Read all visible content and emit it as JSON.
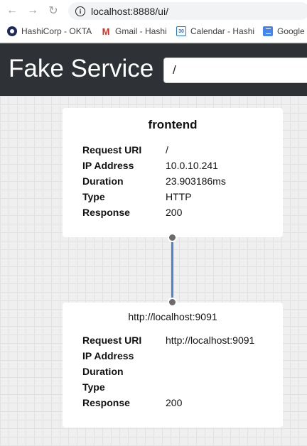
{
  "browser": {
    "url": "localhost:8888/ui/",
    "bookmarks": [
      {
        "label": "HashiCorp - OKTA",
        "icon": "okta-icon"
      },
      {
        "label": "Gmail - Hashi",
        "icon": "gmail-icon"
      },
      {
        "label": "Calendar - Hashi",
        "icon": "calendar-icon"
      },
      {
        "label": "Google",
        "icon": "docs-icon"
      }
    ],
    "gmail_glyph": "M",
    "calendar_glyph": "30"
  },
  "app": {
    "title": "Fake Service",
    "path_value": "/"
  },
  "nodes": [
    {
      "name": "frontend",
      "fields": [
        {
          "key": "Request URI",
          "value": "/"
        },
        {
          "key": "IP Address",
          "value": "10.0.10.241"
        },
        {
          "key": "Duration",
          "value": "23.903186ms"
        },
        {
          "key": "Type",
          "value": "HTTP"
        },
        {
          "key": "Response",
          "value": "200"
        }
      ]
    },
    {
      "name": "http://localhost:9091",
      "fields": [
        {
          "key": "Request URI",
          "value": "http://localhost:9091"
        },
        {
          "key": "IP Address",
          "value": ""
        },
        {
          "key": "Duration",
          "value": ""
        },
        {
          "key": "Type",
          "value": ""
        },
        {
          "key": "Response",
          "value": "200"
        }
      ]
    }
  ],
  "colors": {
    "header_bg": "#2e3136",
    "connector": "#4a82d9",
    "port": "#6b6b6b"
  }
}
